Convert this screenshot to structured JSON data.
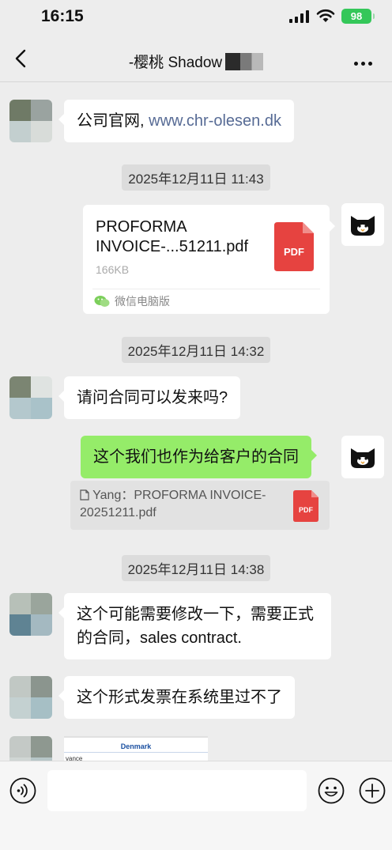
{
  "status_bar": {
    "time": "16:15",
    "battery": "98",
    "icons": [
      "cellular-signal-icon",
      "wifi-icon",
      "battery-icon"
    ]
  },
  "nav": {
    "title": "-樱桃 Shadow",
    "back_icon": "chevron-left-icon",
    "more_icon": "more-dots-icon"
  },
  "messages": {
    "m1": {
      "text_prefix": "公司官网, ",
      "link": "www.chr-olesen.dk"
    },
    "ts1": "2025年12月11日 11:43",
    "file": {
      "name": "PROFORMA INVOICE-...51211.pdf",
      "size": "166KB",
      "type_badge": "PDF",
      "source": "微信电脑版"
    },
    "ts2": "2025年12月11日 14:32",
    "m2": "请问合同可以发来吗?",
    "m3": "这个我们也作为给客户的合同",
    "quote": {
      "text": "Yang：PROFORMA INVOICE-20251211.pdf",
      "badge": "PDF"
    },
    "ts3": "2025年12月11日 14:38",
    "m4": "这个可能需要修改一下，需要正式的合同，sales contract.",
    "m5": "这个形式发票在系统里过不了",
    "image_preview": {
      "header": "Denmark",
      "snippet": "vance"
    }
  },
  "input_bar": {
    "placeholder": "",
    "icons": [
      "voice-icon",
      "emoji-icon",
      "plus-icon"
    ]
  },
  "colors": {
    "background": "#ededed",
    "sent_bubble": "#95ec69",
    "link": "#576b95",
    "pdf_red": "#e64340",
    "battery": "#34c759"
  }
}
